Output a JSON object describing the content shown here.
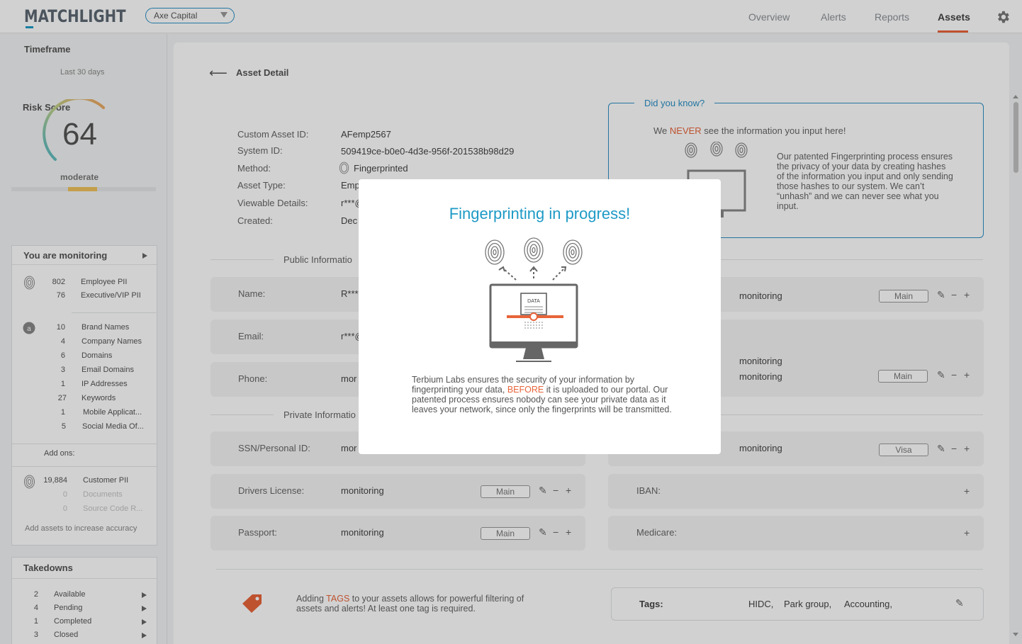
{
  "header": {
    "logo": "MATCHLIGHT",
    "client": "Axe Capital",
    "nav": [
      "Overview",
      "Alerts",
      "Reports",
      "Assets"
    ],
    "active_nav": "Assets"
  },
  "sidebar": {
    "timeframe_title": "Timeframe",
    "timeframe_value": "Last 30 days",
    "risk_title": "Risk Score",
    "risk_score": "64",
    "risk_label": "moderate",
    "risk_score_value": 64,
    "monitoring_title": "You are monitoring",
    "group1": [
      {
        "count": "802",
        "label": "Employee PII"
      },
      {
        "count": "76",
        "label": "Executive/VIP PII"
      }
    ],
    "group2": [
      {
        "count": "10",
        "label": "Brand Names"
      },
      {
        "count": "4",
        "label": "Company Names"
      },
      {
        "count": "6",
        "label": "Domains"
      },
      {
        "count": "3",
        "label": "Email Domains"
      },
      {
        "count": "1",
        "label": "IP Addresses"
      },
      {
        "count": "27",
        "label": "Keywords"
      },
      {
        "count": "1",
        "label": "Mobile Applicat..."
      },
      {
        "count": "5",
        "label": "Social Media Of..."
      }
    ],
    "addons_label": "Add ons:",
    "addons": [
      {
        "count": "19,884",
        "label": "Customer PII"
      },
      {
        "count": "0",
        "label": "Documents"
      },
      {
        "count": "0",
        "label": "Source Code R..."
      }
    ],
    "add_assets": "Add assets to increase accuracy",
    "takedowns_title": "Takedowns",
    "takedowns": [
      {
        "count": "2",
        "label": "Available"
      },
      {
        "count": "4",
        "label": "Pending"
      },
      {
        "count": "1",
        "label": "Completed"
      },
      {
        "count": "3",
        "label": "Closed"
      }
    ]
  },
  "detail": {
    "back_label": "Asset Detail",
    "fields": [
      {
        "label": "Custom Asset ID:",
        "value": "AFemp2567"
      },
      {
        "label": "System ID:",
        "value": "509419ce-b0e0-4d3e-956f-201538b98d29"
      },
      {
        "label": "Method:",
        "value": "Fingerprinted"
      },
      {
        "label": "Asset Type:",
        "value": "Emp"
      },
      {
        "label": "Viewable Details:",
        "value": "r***@"
      },
      {
        "label": "Created:",
        "value": "Dec"
      }
    ]
  },
  "did_you_know": {
    "title": "Did you know?",
    "line_pre": "We ",
    "line_em": "NEVER",
    "line_post": " see the information you input here!",
    "body": "Our patented Fingerprinting process ensures the privacy of your data by creating hashes of the information you input and only sending those hashes to our system. We can’t “unhash” and we can never see what you input."
  },
  "public_section": {
    "title": "Public Informatio",
    "rows": [
      {
        "label": "Name:",
        "value": "R***"
      },
      {
        "label": "Email:",
        "value": "r***@"
      },
      {
        "label": "Phone:",
        "value": "mor"
      }
    ],
    "right_rows": [
      {
        "value": "monitoring",
        "tag": "Main"
      },
      {
        "value": "monitoring",
        "tag": ""
      },
      {
        "value": "monitoring",
        "tag": "Main"
      }
    ]
  },
  "private_section": {
    "title": "Private Informatio",
    "rows": [
      {
        "label": "SSN/Personal ID:",
        "value": "mor"
      },
      {
        "label": "Drivers License:",
        "value": "monitoring",
        "tag": "Main"
      },
      {
        "label": "Passport:",
        "value": "monitoring",
        "tag": "Main"
      }
    ],
    "right_rows": [
      {
        "label": "",
        "value": "monitoring",
        "tag": "Visa"
      },
      {
        "label": "IBAN:",
        "value": "",
        "tag": ""
      },
      {
        "label": "Medicare:",
        "value": "",
        "tag": ""
      }
    ]
  },
  "tags": {
    "hint_pre": "Adding ",
    "hint_em": "TAGS",
    "hint_post": " to your assets allows for powerful filtering of assets and alerts! At least one tag is required.",
    "label": "Tags:",
    "values": [
      "HIDC,",
      "Park group,",
      "Accounting,"
    ]
  },
  "modal": {
    "title": "Fingerprinting in progress!",
    "screen_label": "DATA",
    "body_pre": "Terbium Labs ensures the security of your information by fingerprinting your data, ",
    "body_em": "BEFORE",
    "body_post": " it is uploaded to our portal. Our patented process ensures nobody can see your private data as it leaves your network, since only the fingerprints will be transmitted."
  },
  "colors": {
    "accent": "#1e9ac6",
    "highlight": "#e8643a",
    "risk_moderate": "#f0c25c"
  }
}
